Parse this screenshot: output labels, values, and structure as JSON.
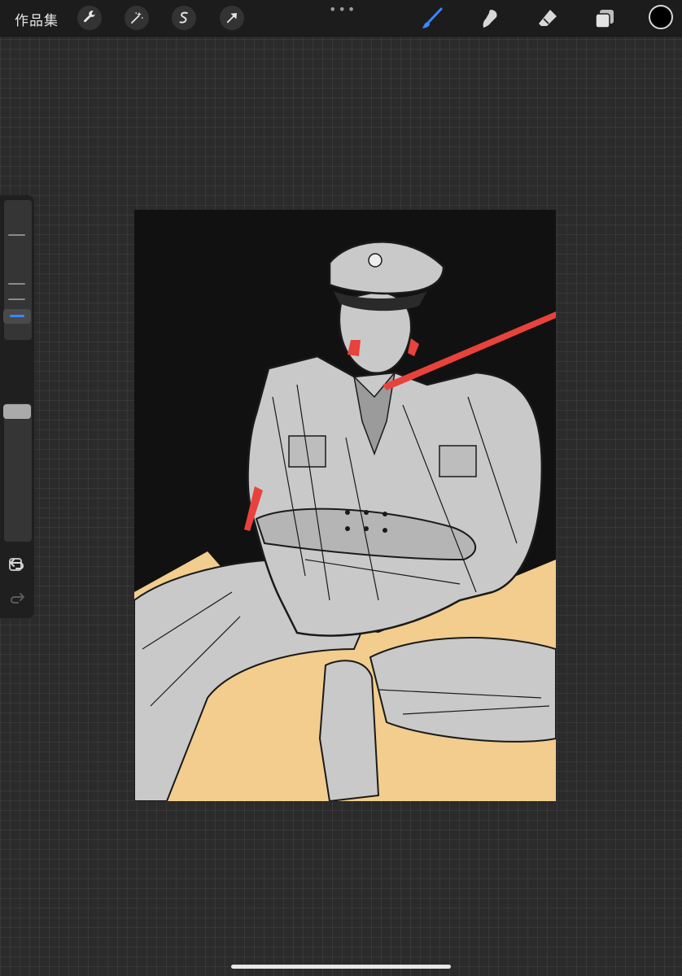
{
  "topbar": {
    "gallery_label": "作品集",
    "more_label": "•••",
    "tools_left": [
      "wrench-icon",
      "magic-wand-icon",
      "selection-icon",
      "transform-arrow-icon"
    ],
    "tools_right": [
      "brush-icon",
      "smudge-icon",
      "eraser-icon",
      "layers-icon"
    ],
    "active_tool": "brush-icon",
    "accent_color": "#3a86ff",
    "current_color": "#000000"
  },
  "sidebar": {
    "brush_size_level": 0.72,
    "opacity_level": 1.0,
    "modify_icon": "square-icon",
    "undo_icon": "undo-arrow-icon",
    "redo_icon": "redo-arrow-icon"
  },
  "canvas": {
    "background_color": "#111111",
    "fill_color": "#f2cd8e",
    "figure_color": "#c9c9c9",
    "accent_color": "#e8423c"
  }
}
